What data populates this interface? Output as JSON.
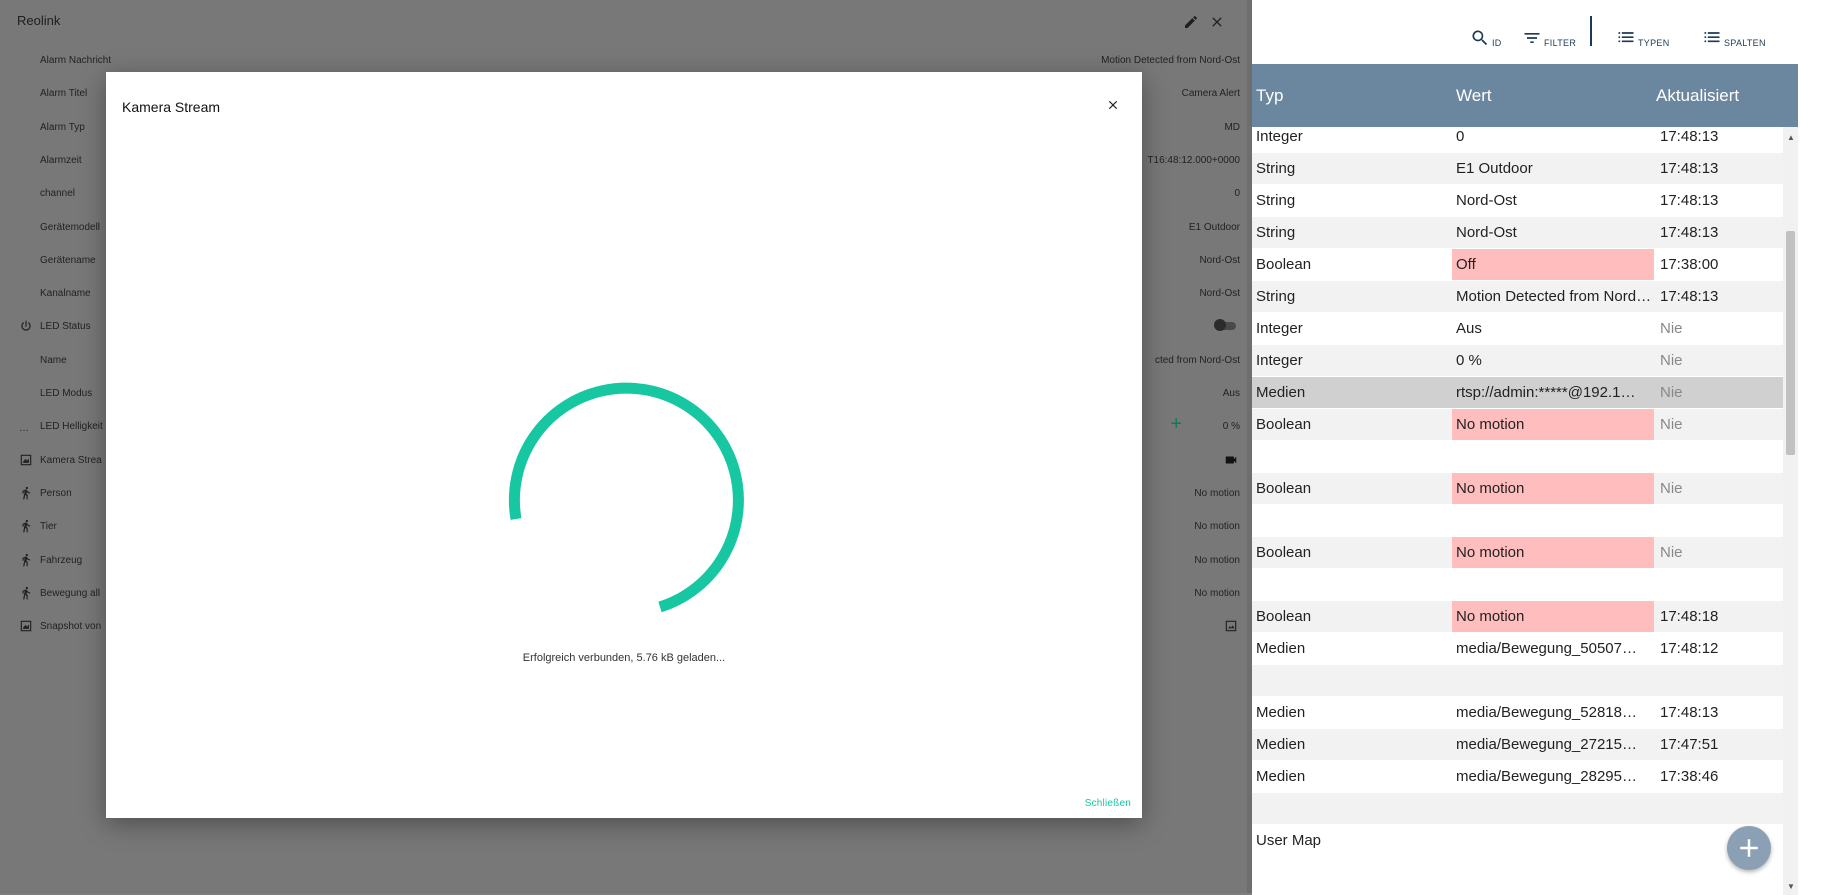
{
  "toolbar": {
    "id_label": "ID",
    "filter_label": "FILTER",
    "types_label": "TYPEN",
    "columns_label": "SPALTEN"
  },
  "table": {
    "headers": {
      "typ": "Typ",
      "wert": "Wert",
      "aktualisiert": "Aktualisiert"
    },
    "rows": [
      {
        "typ": "Integer",
        "wert": "0",
        "akt": "17:48:13",
        "red": false,
        "nie": false
      },
      {
        "typ": "String",
        "wert": "E1 Outdoor",
        "akt": "17:48:13",
        "red": false,
        "nie": false
      },
      {
        "typ": "String",
        "wert": "Nord-Ost",
        "akt": "17:48:13",
        "red": false,
        "nie": false
      },
      {
        "typ": "String",
        "wert": "Nord-Ost",
        "akt": "17:48:13",
        "red": false,
        "nie": false
      },
      {
        "typ": "Boolean",
        "wert": "Off",
        "akt": "17:38:00",
        "red": true,
        "nie": false
      },
      {
        "typ": "String",
        "wert": "Motion Detected from Nord-Ost",
        "akt": "17:48:13",
        "red": false,
        "nie": false
      },
      {
        "typ": "Integer",
        "wert": "Aus",
        "akt": "Nie",
        "red": false,
        "nie": true
      },
      {
        "typ": "Integer",
        "wert": "0 %",
        "akt": "Nie",
        "red": false,
        "nie": true
      },
      {
        "typ": "Medien",
        "wert": "rtsp://admin:*****@192.1…",
        "akt": "Nie",
        "red": false,
        "nie": true
      },
      {
        "typ": "Boolean",
        "wert": "No motion",
        "akt": "Nie",
        "red": true,
        "nie": true
      },
      {
        "typ": "",
        "wert": "",
        "akt": "",
        "red": false,
        "nie": false
      },
      {
        "typ": "Boolean",
        "wert": "No motion",
        "akt": "Nie",
        "red": true,
        "nie": true
      },
      {
        "typ": "",
        "wert": "",
        "akt": "",
        "red": false,
        "nie": false
      },
      {
        "typ": "Boolean",
        "wert": "No motion",
        "akt": "Nie",
        "red": true,
        "nie": true
      },
      {
        "typ": "",
        "wert": "",
        "akt": "",
        "red": false,
        "nie": false
      },
      {
        "typ": "Boolean",
        "wert": "No motion",
        "akt": "17:48:18",
        "red": true,
        "nie": false
      },
      {
        "typ": "Medien",
        "wert": "media/Bewegung_50507…",
        "akt": "17:48:12",
        "red": false,
        "nie": false
      },
      {
        "typ": "",
        "wert": "",
        "akt": "",
        "red": false,
        "nie": false
      },
      {
        "typ": "Medien",
        "wert": "media/Bewegung_52818…",
        "akt": "17:48:13",
        "red": false,
        "nie": false
      },
      {
        "typ": "Medien",
        "wert": "media/Bewegung_27215…",
        "akt": "17:47:51",
        "red": false,
        "nie": false
      },
      {
        "typ": "Medien",
        "wert": "media/Bewegung_28295…",
        "akt": "17:38:46",
        "red": false,
        "nie": false
      },
      {
        "typ": "",
        "wert": "",
        "akt": "",
        "red": false,
        "nie": false
      },
      {
        "typ": "User Map",
        "wert": "",
        "akt": "",
        "red": false,
        "nie": false
      }
    ]
  },
  "panel": {
    "title": "Reolink",
    "rows": [
      {
        "label": "Alarm Nachricht",
        "value": "Motion Detected from Nord-Ost",
        "icon": ""
      },
      {
        "label": "Alarm Titel",
        "value": "Camera Alert",
        "icon": ""
      },
      {
        "label": "Alarm Typ",
        "value": "MD",
        "icon": ""
      },
      {
        "label": "Alarmzeit",
        "value": "T16:48:12.000+0000",
        "icon": ""
      },
      {
        "label": "channel",
        "value": "0",
        "icon": ""
      },
      {
        "label": "Gerätemodell",
        "value": "E1 Outdoor",
        "icon": ""
      },
      {
        "label": "Gerätename",
        "value": "Nord-Ost",
        "icon": ""
      },
      {
        "label": "Kanalname",
        "value": "Nord-Ost",
        "icon": ""
      },
      {
        "label": "LED Status",
        "value": "",
        "icon": "power-icon",
        "toggle": true
      },
      {
        "label": "Name",
        "value": "cted from Nord-Ost",
        "icon": ""
      },
      {
        "label": "LED Modus",
        "value": "Aus",
        "icon": ""
      },
      {
        "label": "LED Helligkeit",
        "value": "0 %",
        "icon": "dots-icon",
        "plus": true
      },
      {
        "label": "Kamera Strea",
        "value": "",
        "icon": "chart-icon",
        "camera": true
      },
      {
        "label": "Person",
        "value": "No motion",
        "icon": "runner-icon"
      },
      {
        "label": "Tier",
        "value": "No motion",
        "icon": "runner-icon"
      },
      {
        "label": "Fahrzeug",
        "value": "No motion",
        "icon": "runner-icon"
      },
      {
        "label": "Bewegung all",
        "value": "No motion",
        "icon": "runner-icon"
      },
      {
        "label": "Snapshot von",
        "value": "",
        "icon": "chart-icon",
        "image": true
      }
    ]
  },
  "modal": {
    "title": "Kamera Stream",
    "status": "Erfolgreich verbunden, 5.76 kB geladen...",
    "close_label": "Schließen",
    "spinner_color": "#16c7a2"
  }
}
